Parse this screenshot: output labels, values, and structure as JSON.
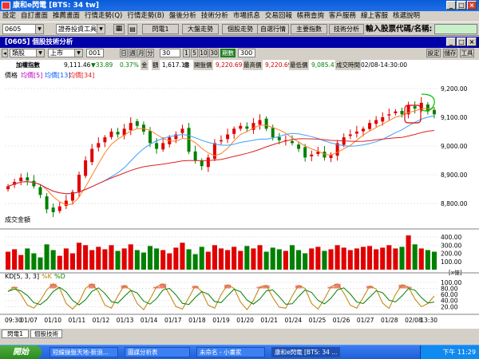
{
  "window": {
    "title": "康和e閃電 [BTS: 34 tw]"
  },
  "menu": [
    "設定",
    "自訂畫面",
    "推薦畫面",
    "行情走勢(Q)",
    "行情走勢(B)",
    "盤後分析",
    "技術分析",
    "市場訊息",
    "交易回報",
    "帳務查詢",
    "客戶服務",
    "線上客服",
    "核選說明"
  ],
  "toolbar": {
    "code": "0605",
    "dropdown": "證券投資工具",
    "buttons": [
      "閃電1",
      "大盤走勢",
      "個股走勢",
      "自選行情",
      "主要指數",
      "技術分析"
    ],
    "search_label": "輸入股票代碼/名稱:",
    "search_value": ""
  },
  "chart_window": {
    "title": "[0605] 個股技術分析"
  },
  "controls": {
    "kind": "類股",
    "market": "上市",
    "code": "001",
    "periods": [
      "日",
      "週",
      "月",
      "分"
    ],
    "period_value": "30",
    "steps": [
      "1",
      "5",
      "10",
      "30"
    ],
    "step_label": "期數",
    "step_value": "300",
    "right": [
      "設定",
      "儲存",
      "工具"
    ]
  },
  "info": {
    "name": "加權指數",
    "price": "9,111.46",
    "change": "▼33.89",
    "pct": "0.37%",
    "amount_label": "金",
    "amount_label2": "額",
    "amount": "1,617.18",
    "unit": "億",
    "open_label": "開盤價",
    "open": "9,220.69",
    "high_label": "最高價",
    "high": "9,220.69",
    "low_label": "最低價",
    "low": "9,085.41",
    "time_label": "成交時間",
    "time": "02/08-14:30:00"
  },
  "chart_data": [
    {
      "type": "candlestick",
      "title": "價格",
      "legend": [
        "均價[5]",
        "均價[13]",
        "均價[34]"
      ],
      "y_ticks": [
        "9,200.00",
        "9,100.00",
        "9,000.00",
        "8,900.00",
        "8,800.00"
      ],
      "ylim": [
        8720,
        9230
      ],
      "ma_colors": [
        "#ff7f27",
        "#40a0ff",
        "#e02020"
      ],
      "up_color": "#e00000",
      "down_color": "#008000",
      "close": [
        8860,
        8875,
        8890,
        8880,
        8860,
        8830,
        8780,
        8770,
        8790,
        8810,
        8840,
        8900,
        8950,
        8990,
        9010,
        9030,
        9050,
        9040,
        9060,
        9080,
        9070,
        9050,
        9010,
        8990,
        9010,
        9030,
        9040,
        9060,
        8980,
        8950,
        8930,
        8960,
        9010,
        9020,
        9040,
        9060,
        9070,
        9060,
        9080,
        9090,
        9060,
        9030,
        9020,
        9020,
        9010,
        8990,
        8960,
        8970,
        8980,
        8960,
        8970,
        9010,
        9030,
        9040,
        9050,
        9060,
        9080,
        9090,
        9100,
        9110,
        9120,
        9110,
        9140,
        9130,
        9150,
        9120,
        9110
      ]
    },
    {
      "type": "bar",
      "title": "成交金額",
      "y_ticks": [
        "400.00",
        "300.00",
        "200.00",
        "100.00"
      ],
      "unit": "[x億]",
      "ylim": [
        0,
        450
      ],
      "values": [
        220,
        250,
        180,
        260,
        200,
        150,
        310,
        240,
        170,
        260,
        200,
        330,
        300,
        240,
        280,
        250,
        300,
        230,
        260,
        310,
        240,
        210,
        290,
        260,
        240,
        200,
        270,
        330,
        250,
        190,
        280,
        220,
        300,
        260,
        240,
        280,
        230,
        290,
        260,
        300,
        220,
        270,
        250,
        230,
        300,
        240,
        200,
        260,
        280,
        230,
        250,
        300,
        270,
        240,
        260,
        280,
        290,
        250,
        270,
        300,
        260,
        280,
        420,
        310,
        260,
        240,
        220
      ]
    },
    {
      "type": "line",
      "title": "KD[5, 3, 3]",
      "legend": [
        "%K",
        "%D"
      ],
      "y_ticks": [
        "100.00",
        "80.00",
        "60.00",
        "40.00",
        "20.00"
      ],
      "ylim": [
        0,
        110
      ],
      "k": [
        70,
        85,
        60,
        25,
        15,
        40,
        75,
        95,
        80,
        30,
        12,
        35,
        80,
        95,
        70,
        25,
        15,
        55,
        90,
        75,
        30,
        10,
        45,
        85,
        95,
        60,
        20,
        12,
        50,
        88,
        70,
        25,
        15,
        60,
        92,
        80,
        35,
        10,
        40,
        85,
        90,
        50,
        18,
        15,
        55,
        90,
        80,
        30,
        12,
        45,
        85,
        95,
        65,
        25,
        15,
        50,
        88,
        78,
        32,
        14,
        60,
        92,
        85,
        45,
        20,
        30,
        55
      ]
    },
    {
      "type": "axis",
      "x_ticks": [
        "09:30",
        "01/07",
        "01/10",
        "01/11",
        "01/12",
        "01/13",
        "01/14",
        "01/17",
        "01/18",
        "01/19",
        "01/20",
        "01/21",
        "01/24",
        "01/25",
        "01/26",
        "01/27",
        "01/28",
        "02/08",
        "13:30"
      ]
    }
  ],
  "status": {
    "tab1": "閃電1",
    "tab2": "個股技術"
  },
  "taskbar": {
    "start": "開始",
    "tasks": [
      "短線操盤天地-新浪...",
      "圖謀分析表",
      "未命名 - 小畫家",
      "康和e閃電 [BTS: 34 ..."
    ],
    "clock": "下午 11:29"
  }
}
